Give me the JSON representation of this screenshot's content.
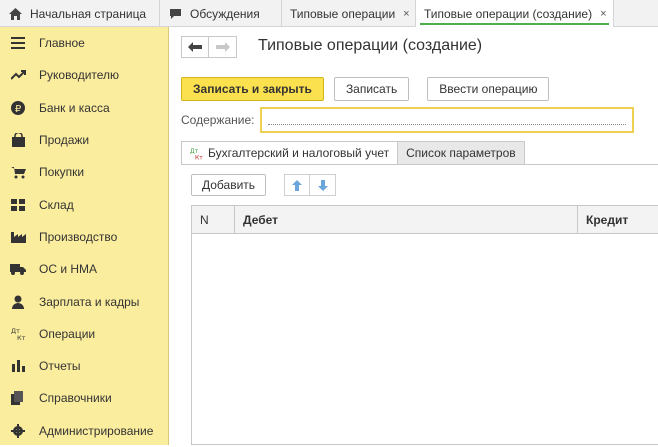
{
  "tabs": [
    {
      "label": "Начальная страница",
      "icon": "home-icon"
    },
    {
      "label": "Обсуждения",
      "icon": "chat-icon"
    },
    {
      "label": "Типовые операции",
      "close": "×"
    },
    {
      "label": "Типовые операции (создание)",
      "close": "×",
      "active": true
    }
  ],
  "sidebar": {
    "items": [
      {
        "label": "Главное",
        "icon": "menu-icon"
      },
      {
        "label": "Руководителю",
        "icon": "trend-icon"
      },
      {
        "label": "Банк и касса",
        "icon": "ruble-icon"
      },
      {
        "label": "Продажи",
        "icon": "bag-icon"
      },
      {
        "label": "Покупки",
        "icon": "cart-icon"
      },
      {
        "label": "Склад",
        "icon": "warehouse-icon"
      },
      {
        "label": "Производство",
        "icon": "factory-icon"
      },
      {
        "label": "ОС и НМА",
        "icon": "truck-icon"
      },
      {
        "label": "Зарплата и кадры",
        "icon": "person-icon"
      },
      {
        "label": "Операции",
        "icon": "dt-kt-icon"
      },
      {
        "label": "Отчеты",
        "icon": "bar-chart-icon"
      },
      {
        "label": "Справочники",
        "icon": "books-icon"
      },
      {
        "label": "Администрирование",
        "icon": "gear-icon"
      }
    ]
  },
  "form": {
    "title": "Типовые операции (создание)",
    "buttons": {
      "save_close": "Записать и закрыть",
      "save": "Записать",
      "enter_op": "Ввести операцию"
    },
    "content_label": "Содержание:",
    "content_value": ""
  },
  "inner_tabs": [
    {
      "label": "Бухгалтерский и налоговый учет",
      "icon": "dt-kt-icon"
    },
    {
      "label": "Список параметров"
    }
  ],
  "table": {
    "add_label": "Добавить",
    "columns": [
      "N",
      "Дебет",
      "Кредит"
    ],
    "rows": []
  },
  "colors": {
    "sidebar_bg": "#fbed9e",
    "primary_button": "#fbe14d",
    "active_tab_underline": "#4caf50",
    "arrow_blue": "#6aa6dc"
  }
}
